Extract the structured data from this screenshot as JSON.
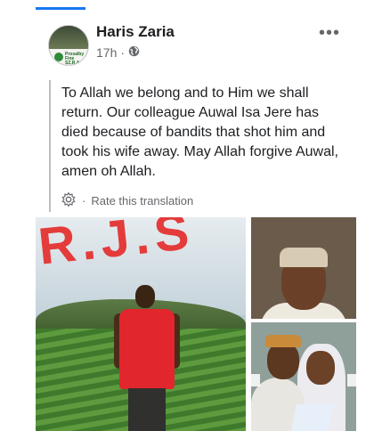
{
  "post": {
    "author": "Haris Zaria",
    "time": "17h",
    "separator": "·",
    "audience_icon": "globe-icon",
    "more_icon": "more-icon",
    "more_label": "•••",
    "text": "To Allah we belong and to Him we shall return. Our colleague Auwal Isa Jere has died because of bandits that shot him and took his wife away. May Allah forgive Auwal, amen oh Allah.",
    "translation": {
      "icon": "gear-icon",
      "separator": "·",
      "label": "Rate this translation"
    }
  },
  "avatar": {
    "caption": "Prosalby Fine SZ.R.A.Y"
  },
  "photos": {
    "main_overlay_text": "R.J.S",
    "count": 3
  },
  "colors": {
    "accent": "#1877f2",
    "muted": "#65676b",
    "overlay_red": "#e43b3b"
  }
}
